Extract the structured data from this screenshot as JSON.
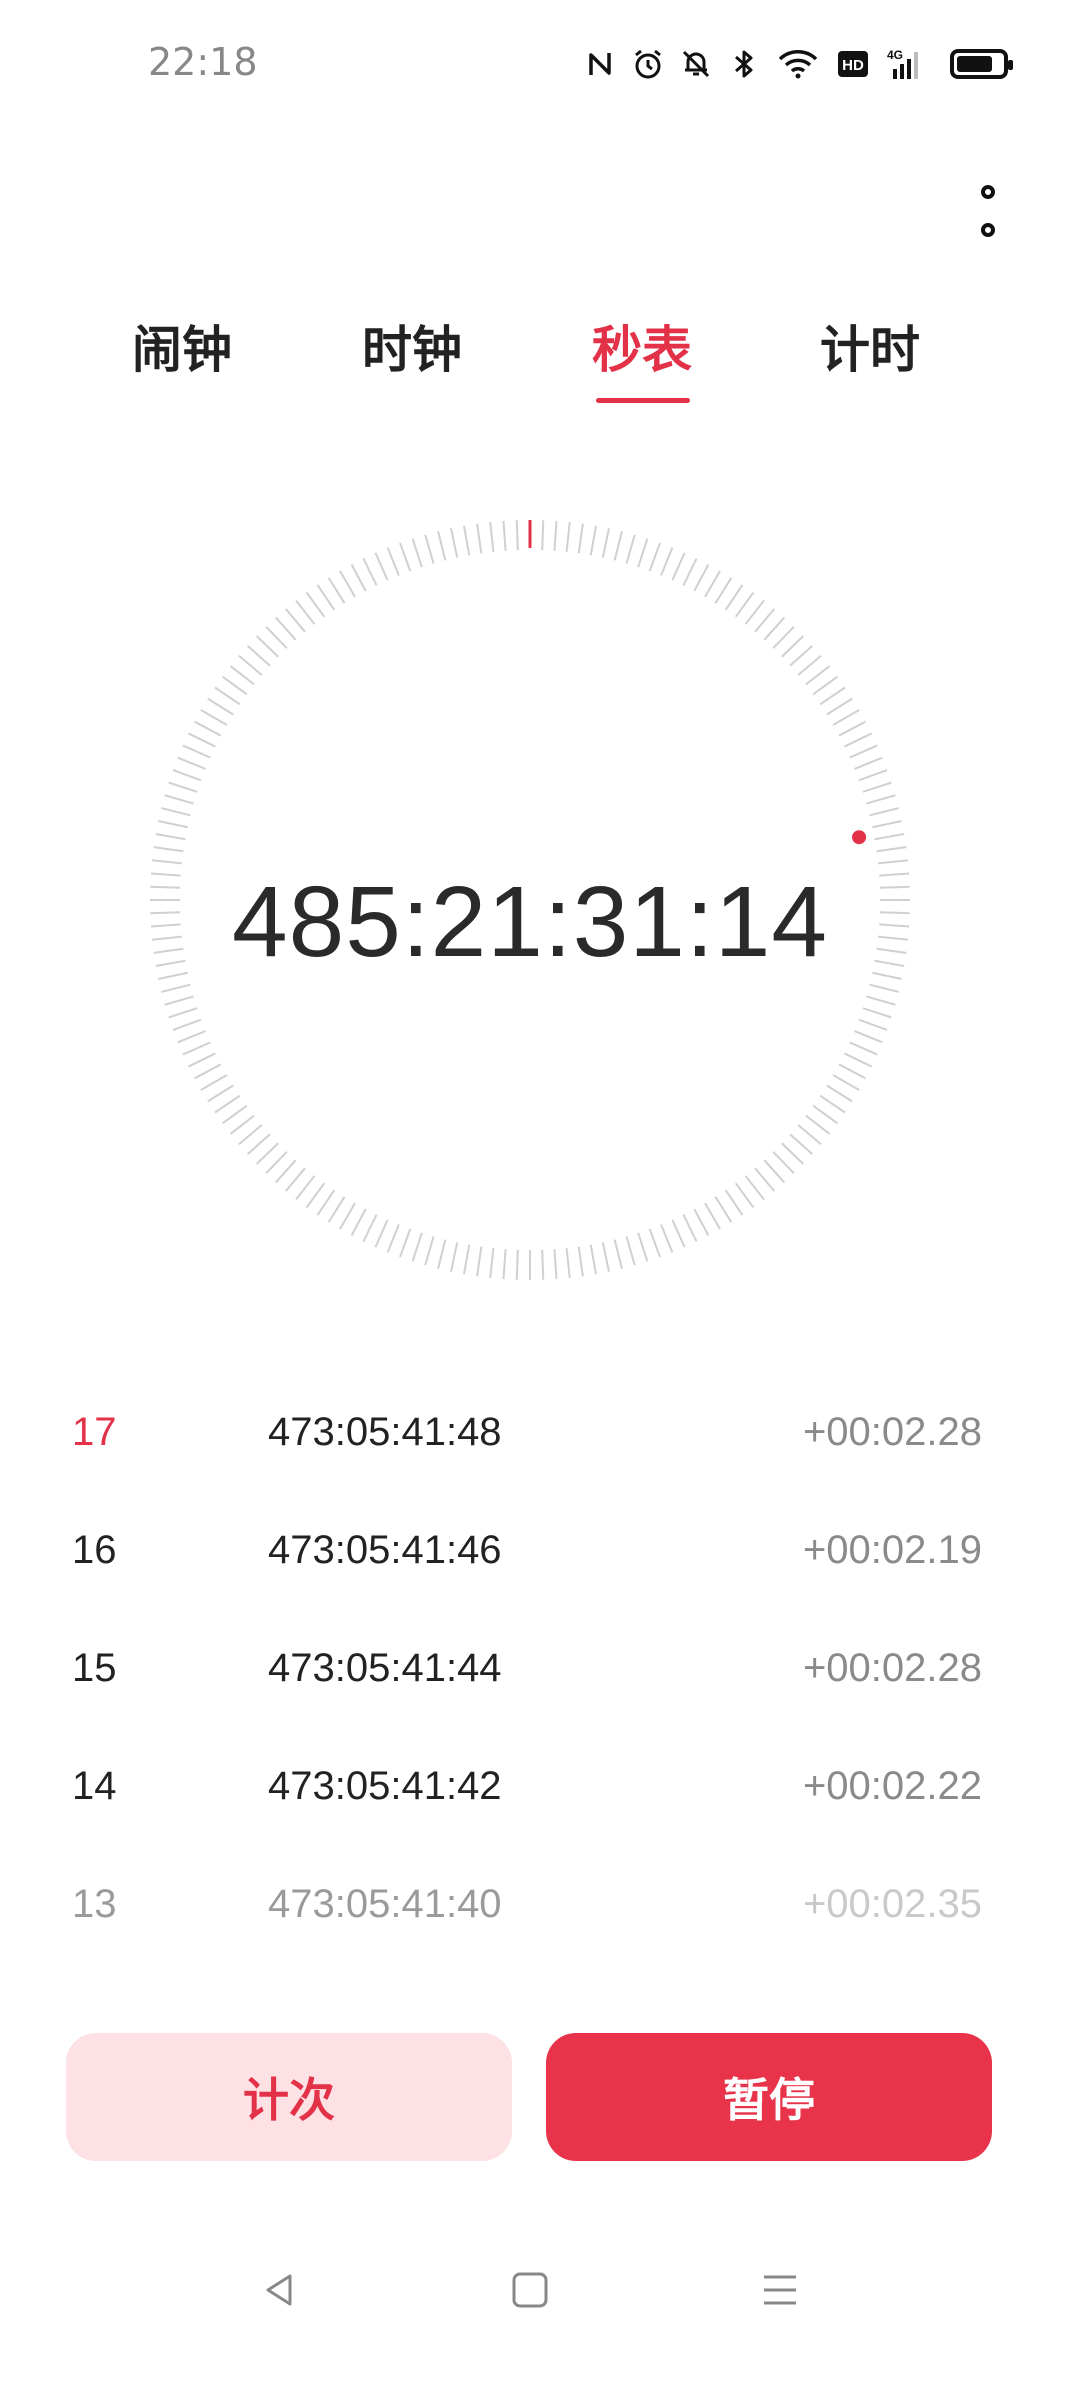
{
  "status_bar": {
    "time": "22:18",
    "icons": [
      "nfc-icon",
      "alarm-icon",
      "mute-bell-icon",
      "bluetooth-icon",
      "wifi-icon",
      "hd-icon",
      "4g-signal-icon",
      "battery-icon"
    ],
    "hd_label": "HD",
    "network_label": "4G",
    "battery_level": 0.8
  },
  "tabs": [
    {
      "label": "闹钟",
      "active": false
    },
    {
      "label": "时钟",
      "active": false
    },
    {
      "label": "秒表",
      "active": true
    },
    {
      "label": "计时",
      "active": false
    }
  ],
  "stopwatch": {
    "display": "485:21:31:14",
    "seconds_hand_fraction": 0.22
  },
  "laps": [
    {
      "number": "17",
      "total": "473:05:41:48",
      "diff": "+00:02.28",
      "current": true
    },
    {
      "number": "16",
      "total": "473:05:41:46",
      "diff": "+00:02.19",
      "current": false
    },
    {
      "number": "15",
      "total": "473:05:41:44",
      "diff": "+00:02.28",
      "current": false
    },
    {
      "number": "14",
      "total": "473:05:41:42",
      "diff": "+00:02.22",
      "current": false
    },
    {
      "number": "13",
      "total": "473:05:41:40",
      "diff": "+00:02.35",
      "current": false
    }
  ],
  "buttons": {
    "lap_label": "计次",
    "pause_label": "暂停"
  },
  "nav": {
    "icons": [
      "back-icon",
      "home-icon",
      "menu-icon"
    ]
  },
  "colors": {
    "accent": "#e33148",
    "accent_light": "#fde1e4",
    "tick": "#d0d0d0"
  }
}
